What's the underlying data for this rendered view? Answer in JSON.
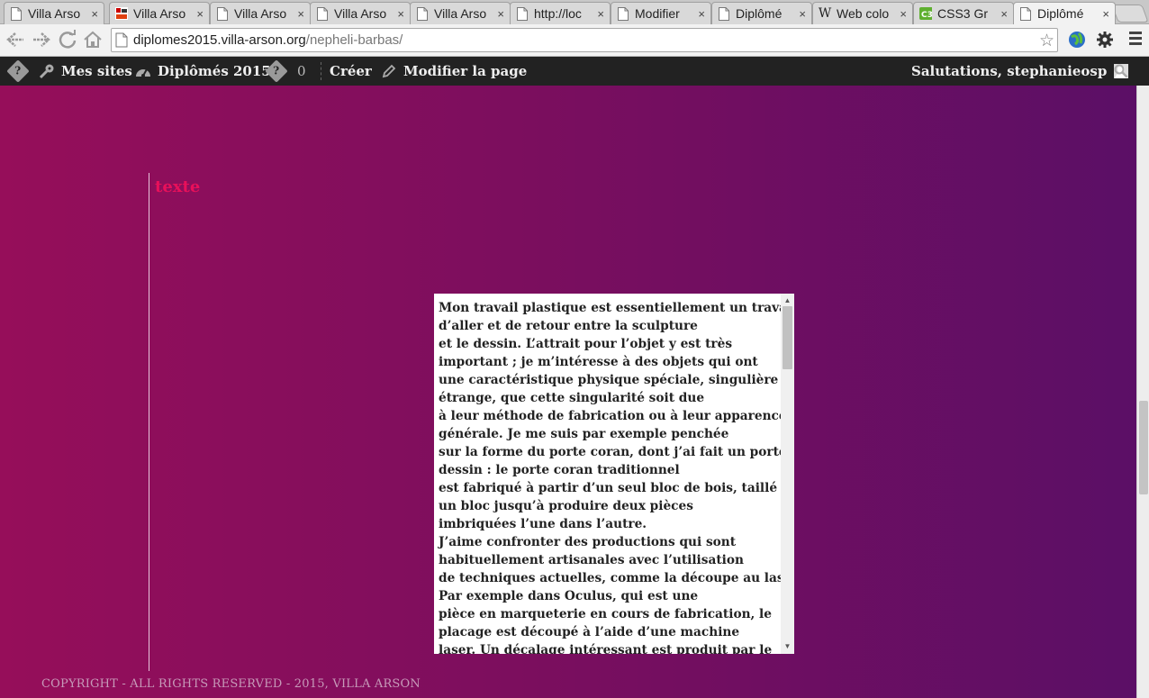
{
  "browser": {
    "tabs": [
      {
        "title": "Villa Arso",
        "icon": "page-icon"
      },
      {
        "title": "Villa Arso",
        "icon": "site-favicon"
      },
      {
        "title": "Villa Arso",
        "icon": "page-icon"
      },
      {
        "title": "Villa Arso",
        "icon": "page-icon"
      },
      {
        "title": "Villa Arso",
        "icon": "page-icon"
      },
      {
        "title": "http://loc",
        "icon": "page-icon"
      },
      {
        "title": "Modifier",
        "icon": "page-icon"
      },
      {
        "title": "Diplômé",
        "icon": "page-icon"
      },
      {
        "title": "Web colo",
        "icon": "wikipedia-icon"
      },
      {
        "title": "CSS3 Gr",
        "icon": "css3-icon"
      },
      {
        "title": "Diplômé",
        "icon": "page-icon"
      }
    ],
    "close_glyph": "×",
    "url_host": "diplomes2015.villa-arson.org",
    "url_path": "/nepheli-barbas/"
  },
  "adminbar": {
    "wp_logo": "?",
    "my_sites": "Mes sites",
    "site_name": "Diplômés 2015",
    "comments_icon": "?",
    "comments_count": "0",
    "new": "Créer",
    "edit_page": "Modifier la page",
    "greeting": "Salutations, stephanieosp"
  },
  "page": {
    "section_title": "texte",
    "text_lines": [
      "Mon travail plastique est essentiellement un travail",
      "d’aller et de retour entre la sculpture",
      "et le dessin. L’attrait pour l’objet y est très",
      "important ; je m’intéresse à des objets qui ont",
      "une caractéristique physique spéciale, singulière ou",
      "étrange, que cette singularité soit due",
      "à leur méthode de fabrication ou à leur apparence",
      "générale. Je me suis par exemple penchée",
      "sur la forme du porte coran, dont j’ai fait un porte",
      "dessin : le porte coran traditionnel",
      "est fabriqué à partir d’un seul bloc de bois, taillé en",
      "un bloc jusqu’à produire deux pièces",
      "imbriquées l’une dans l’autre.",
      "J’aime confronter des productions qui sont",
      "habituellement artisanales avec l’utilisation",
      "de techniques actuelles, comme la découpe au laser.",
      "Par exemple dans Oculus, qui est une",
      "pièce en marqueterie en cours de fabrication, le",
      "placage est découpé à l’aide d’une machine",
      "laser. Un décalage intéressant est produit par le"
    ],
    "footer": "COPYRIGHT - ALL RIGHTS RESERVED - 2015, VILLA ARSON"
  },
  "colors": {
    "accent_title": "#e8105a",
    "gradient_start": "#960e5a",
    "gradient_end": "#5b0f66",
    "adminbar_bg": "#222222"
  }
}
